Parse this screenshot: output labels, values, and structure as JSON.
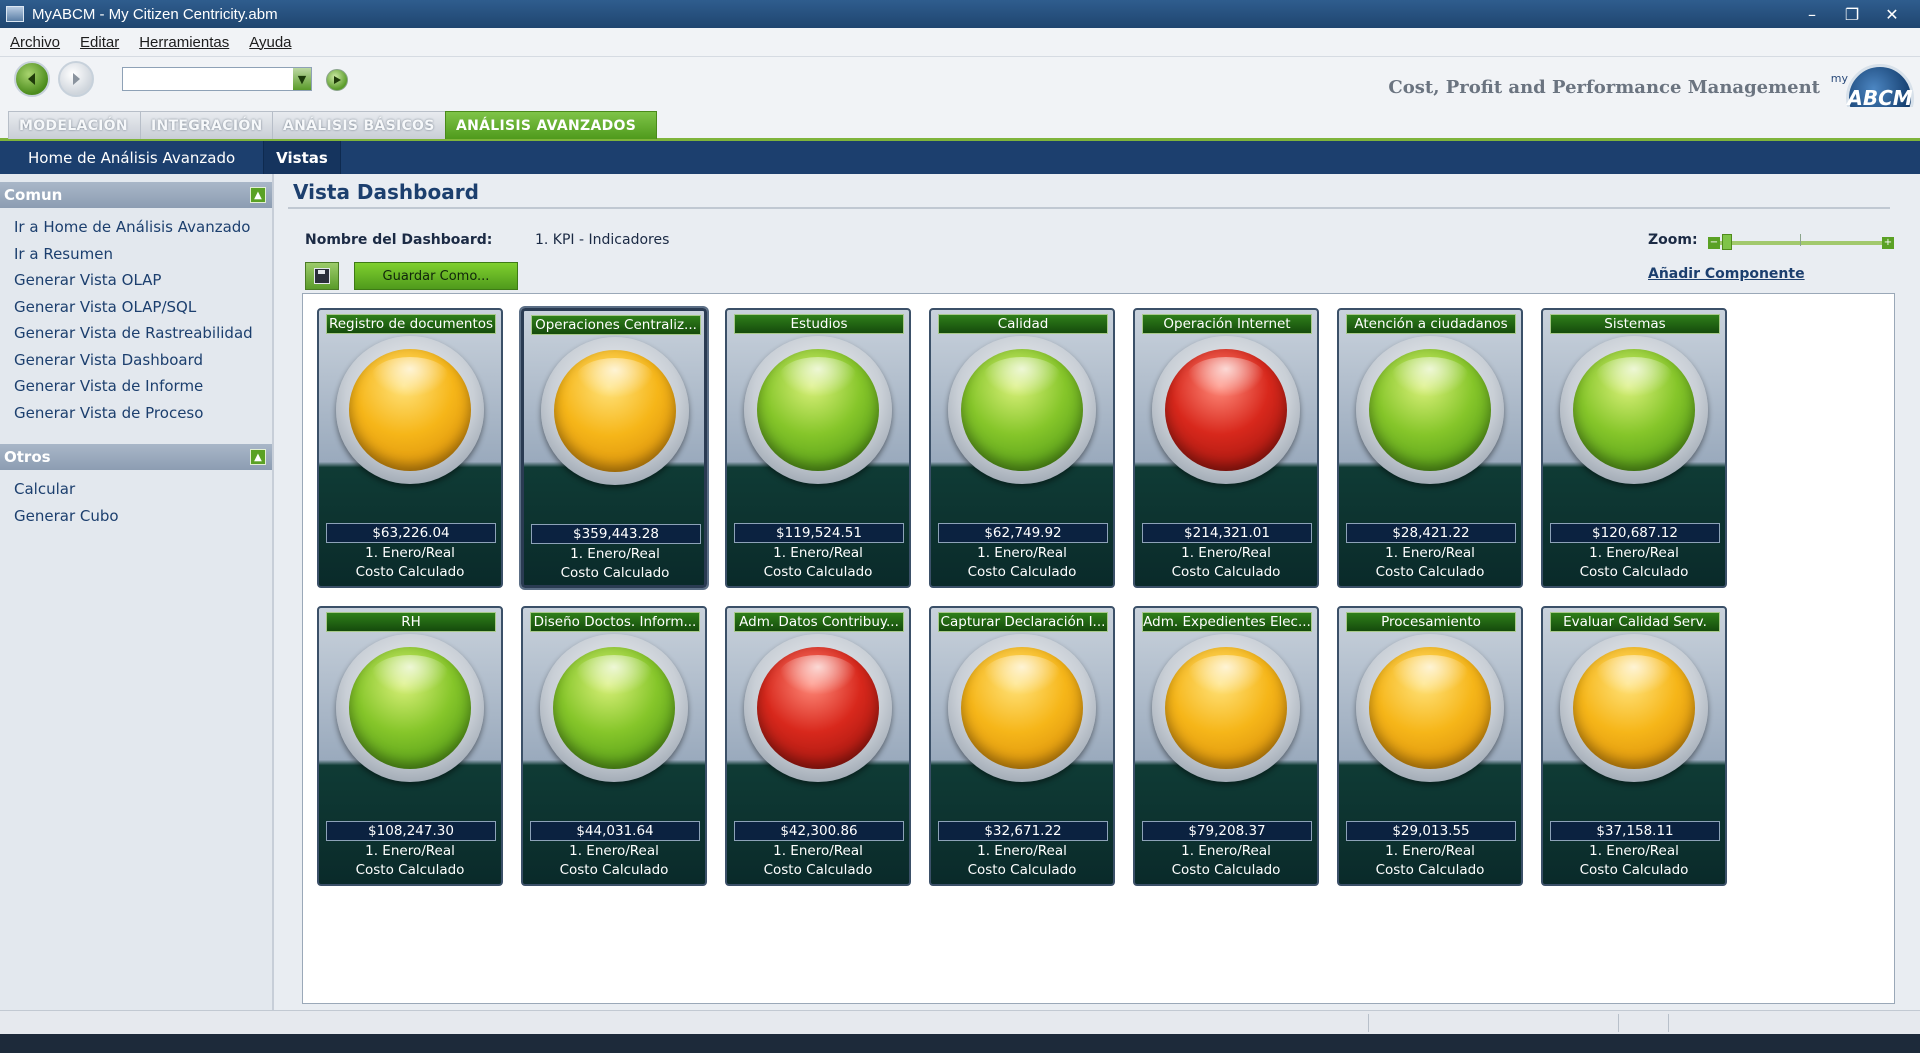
{
  "window": {
    "title": "MyABCM  - My Citizen Centricity.abm"
  },
  "menu": [
    "Archivo",
    "Editar",
    "Herramientas",
    "Ayuda"
  ],
  "toolbar": {
    "tagline": "Cost, Profit and Performance Management",
    "logo_small": "my",
    "logo_text": "ABCM"
  },
  "tabs": [
    "MODELACIÓN",
    "INTEGRACIÓN",
    "ANÁLISIS BÁSICOS",
    "ANÁLISIS AVANZADOS"
  ],
  "subnav": [
    "Home de Análisis Avanzado",
    "Vistas"
  ],
  "sidebar": {
    "comun_title": "Comun",
    "comun_items": [
      "Ir a Home de Análisis Avanzado",
      "Ir a Resumen",
      "Generar Vista OLAP",
      "Generar Vista OLAP/SQL",
      "Generar Vista de Rastreabilidad",
      "Generar Vista Dashboard",
      "Generar Vista de Informe",
      "Generar Vista de Proceso"
    ],
    "otros_title": "Otros",
    "otros_items": [
      "Calcular",
      "Generar Cubo"
    ]
  },
  "main": {
    "title": "Vista Dashboard",
    "dashboard_name_label": "Nombre del Dashboard:",
    "dashboard_name_value": "1. KPI - Indicadores",
    "save_as_label": "Guardar Como...",
    "zoom_label": "Zoom:",
    "add_component_label": "Añadir Componente"
  },
  "status_colors": {
    "green": "#86c62a",
    "yellow": "#f6b619",
    "red": "#d8281c",
    "accent": "#4f9a1c",
    "nav": "#1c3f6e"
  },
  "kpis": [
    {
      "title": "Registro de documentos",
      "status": "yellow",
      "value": "$63,226.04",
      "period": "1. Enero/Real",
      "measure": "Costo Calculado"
    },
    {
      "title": "Operaciones Centraliz...",
      "status": "yellow",
      "value": "$359,443.28",
      "period": "1. Enero/Real",
      "measure": "Costo Calculado"
    },
    {
      "title": "Estudios",
      "status": "green",
      "value": "$119,524.51",
      "period": "1. Enero/Real",
      "measure": "Costo Calculado"
    },
    {
      "title": "Calidad",
      "status": "green",
      "value": "$62,749.92",
      "period": "1. Enero/Real",
      "measure": "Costo Calculado"
    },
    {
      "title": "Operación Internet",
      "status": "red",
      "value": "$214,321.01",
      "period": "1. Enero/Real",
      "measure": "Costo Calculado"
    },
    {
      "title": "Atención a ciudadanos",
      "status": "green",
      "value": "$28,421.22",
      "period": "1. Enero/Real",
      "measure": "Costo Calculado"
    },
    {
      "title": "Sistemas",
      "status": "green",
      "value": "$120,687.12",
      "period": "1. Enero/Real",
      "measure": "Costo Calculado"
    },
    {
      "title": "RH",
      "status": "green",
      "value": "$108,247.30",
      "period": "1. Enero/Real",
      "measure": "Costo Calculado"
    },
    {
      "title": "Diseño  Doctos. Inform...",
      "status": "green",
      "value": "$44,031.64",
      "period": "1. Enero/Real",
      "measure": "Costo Calculado"
    },
    {
      "title": "Adm. Datos Contribuy...",
      "status": "red",
      "value": "$42,300.86",
      "period": "1. Enero/Real",
      "measure": "Costo Calculado"
    },
    {
      "title": "Capturar  Declaración I...",
      "status": "yellow",
      "value": "$32,671.22",
      "period": "1. Enero/Real",
      "measure": "Costo Calculado"
    },
    {
      "title": "Adm.  Expedientes Elec...",
      "status": "yellow",
      "value": "$79,208.37",
      "period": "1. Enero/Real",
      "measure": "Costo Calculado"
    },
    {
      "title": "Procesamiento",
      "status": "yellow",
      "value": "$29,013.55",
      "period": "1. Enero/Real",
      "measure": "Costo Calculado"
    },
    {
      "title": "Evaluar Calidad Serv.",
      "status": "yellow",
      "value": "$37,158.11",
      "period": "1. Enero/Real",
      "measure": "Costo Calculado"
    }
  ]
}
